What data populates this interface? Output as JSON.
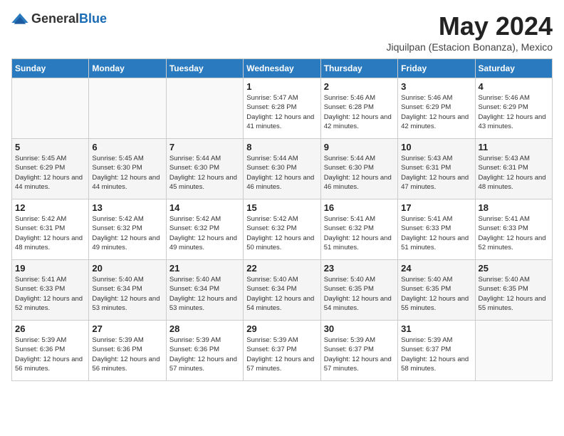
{
  "header": {
    "logo_general": "General",
    "logo_blue": "Blue",
    "month_year": "May 2024",
    "location": "Jiquilpan (Estacion Bonanza), Mexico"
  },
  "days_of_week": [
    "Sunday",
    "Monday",
    "Tuesday",
    "Wednesday",
    "Thursday",
    "Friday",
    "Saturday"
  ],
  "weeks": [
    [
      {
        "day": "",
        "sunrise": "",
        "sunset": "",
        "daylight": ""
      },
      {
        "day": "",
        "sunrise": "",
        "sunset": "",
        "daylight": ""
      },
      {
        "day": "",
        "sunrise": "",
        "sunset": "",
        "daylight": ""
      },
      {
        "day": "1",
        "sunrise": "Sunrise: 5:47 AM",
        "sunset": "Sunset: 6:28 PM",
        "daylight": "Daylight: 12 hours and 41 minutes."
      },
      {
        "day": "2",
        "sunrise": "Sunrise: 5:46 AM",
        "sunset": "Sunset: 6:28 PM",
        "daylight": "Daylight: 12 hours and 42 minutes."
      },
      {
        "day": "3",
        "sunrise": "Sunrise: 5:46 AM",
        "sunset": "Sunset: 6:29 PM",
        "daylight": "Daylight: 12 hours and 42 minutes."
      },
      {
        "day": "4",
        "sunrise": "Sunrise: 5:46 AM",
        "sunset": "Sunset: 6:29 PM",
        "daylight": "Daylight: 12 hours and 43 minutes."
      }
    ],
    [
      {
        "day": "5",
        "sunrise": "Sunrise: 5:45 AM",
        "sunset": "Sunset: 6:29 PM",
        "daylight": "Daylight: 12 hours and 44 minutes."
      },
      {
        "day": "6",
        "sunrise": "Sunrise: 5:45 AM",
        "sunset": "Sunset: 6:30 PM",
        "daylight": "Daylight: 12 hours and 44 minutes."
      },
      {
        "day": "7",
        "sunrise": "Sunrise: 5:44 AM",
        "sunset": "Sunset: 6:30 PM",
        "daylight": "Daylight: 12 hours and 45 minutes."
      },
      {
        "day": "8",
        "sunrise": "Sunrise: 5:44 AM",
        "sunset": "Sunset: 6:30 PM",
        "daylight": "Daylight: 12 hours and 46 minutes."
      },
      {
        "day": "9",
        "sunrise": "Sunrise: 5:44 AM",
        "sunset": "Sunset: 6:30 PM",
        "daylight": "Daylight: 12 hours and 46 minutes."
      },
      {
        "day": "10",
        "sunrise": "Sunrise: 5:43 AM",
        "sunset": "Sunset: 6:31 PM",
        "daylight": "Daylight: 12 hours and 47 minutes."
      },
      {
        "day": "11",
        "sunrise": "Sunrise: 5:43 AM",
        "sunset": "Sunset: 6:31 PM",
        "daylight": "Daylight: 12 hours and 48 minutes."
      }
    ],
    [
      {
        "day": "12",
        "sunrise": "Sunrise: 5:42 AM",
        "sunset": "Sunset: 6:31 PM",
        "daylight": "Daylight: 12 hours and 48 minutes."
      },
      {
        "day": "13",
        "sunrise": "Sunrise: 5:42 AM",
        "sunset": "Sunset: 6:32 PM",
        "daylight": "Daylight: 12 hours and 49 minutes."
      },
      {
        "day": "14",
        "sunrise": "Sunrise: 5:42 AM",
        "sunset": "Sunset: 6:32 PM",
        "daylight": "Daylight: 12 hours and 49 minutes."
      },
      {
        "day": "15",
        "sunrise": "Sunrise: 5:42 AM",
        "sunset": "Sunset: 6:32 PM",
        "daylight": "Daylight: 12 hours and 50 minutes."
      },
      {
        "day": "16",
        "sunrise": "Sunrise: 5:41 AM",
        "sunset": "Sunset: 6:32 PM",
        "daylight": "Daylight: 12 hours and 51 minutes."
      },
      {
        "day": "17",
        "sunrise": "Sunrise: 5:41 AM",
        "sunset": "Sunset: 6:33 PM",
        "daylight": "Daylight: 12 hours and 51 minutes."
      },
      {
        "day": "18",
        "sunrise": "Sunrise: 5:41 AM",
        "sunset": "Sunset: 6:33 PM",
        "daylight": "Daylight: 12 hours and 52 minutes."
      }
    ],
    [
      {
        "day": "19",
        "sunrise": "Sunrise: 5:41 AM",
        "sunset": "Sunset: 6:33 PM",
        "daylight": "Daylight: 12 hours and 52 minutes."
      },
      {
        "day": "20",
        "sunrise": "Sunrise: 5:40 AM",
        "sunset": "Sunset: 6:34 PM",
        "daylight": "Daylight: 12 hours and 53 minutes."
      },
      {
        "day": "21",
        "sunrise": "Sunrise: 5:40 AM",
        "sunset": "Sunset: 6:34 PM",
        "daylight": "Daylight: 12 hours and 53 minutes."
      },
      {
        "day": "22",
        "sunrise": "Sunrise: 5:40 AM",
        "sunset": "Sunset: 6:34 PM",
        "daylight": "Daylight: 12 hours and 54 minutes."
      },
      {
        "day": "23",
        "sunrise": "Sunrise: 5:40 AM",
        "sunset": "Sunset: 6:35 PM",
        "daylight": "Daylight: 12 hours and 54 minutes."
      },
      {
        "day": "24",
        "sunrise": "Sunrise: 5:40 AM",
        "sunset": "Sunset: 6:35 PM",
        "daylight": "Daylight: 12 hours and 55 minutes."
      },
      {
        "day": "25",
        "sunrise": "Sunrise: 5:40 AM",
        "sunset": "Sunset: 6:35 PM",
        "daylight": "Daylight: 12 hours and 55 minutes."
      }
    ],
    [
      {
        "day": "26",
        "sunrise": "Sunrise: 5:39 AM",
        "sunset": "Sunset: 6:36 PM",
        "daylight": "Daylight: 12 hours and 56 minutes."
      },
      {
        "day": "27",
        "sunrise": "Sunrise: 5:39 AM",
        "sunset": "Sunset: 6:36 PM",
        "daylight": "Daylight: 12 hours and 56 minutes."
      },
      {
        "day": "28",
        "sunrise": "Sunrise: 5:39 AM",
        "sunset": "Sunset: 6:36 PM",
        "daylight": "Daylight: 12 hours and 57 minutes."
      },
      {
        "day": "29",
        "sunrise": "Sunrise: 5:39 AM",
        "sunset": "Sunset: 6:37 PM",
        "daylight": "Daylight: 12 hours and 57 minutes."
      },
      {
        "day": "30",
        "sunrise": "Sunrise: 5:39 AM",
        "sunset": "Sunset: 6:37 PM",
        "daylight": "Daylight: 12 hours and 57 minutes."
      },
      {
        "day": "31",
        "sunrise": "Sunrise: 5:39 AM",
        "sunset": "Sunset: 6:37 PM",
        "daylight": "Daylight: 12 hours and 58 minutes."
      },
      {
        "day": "",
        "sunrise": "",
        "sunset": "",
        "daylight": ""
      }
    ]
  ]
}
